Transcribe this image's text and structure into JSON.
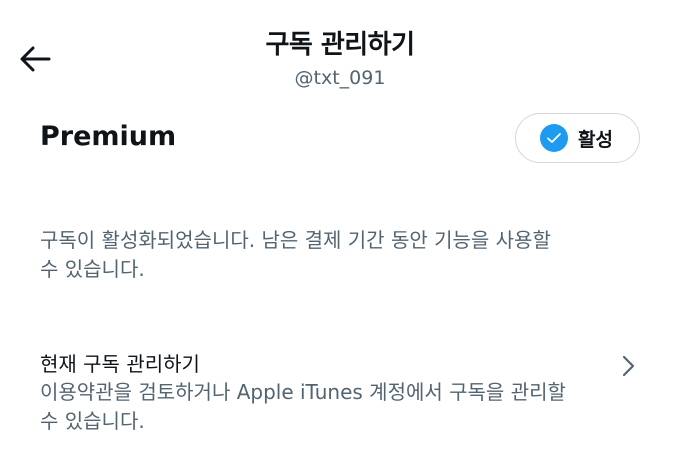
{
  "header": {
    "back_icon": "arrow-left-icon",
    "title": "구독 관리하기",
    "handle": "@txt_091"
  },
  "plan": {
    "name": "Premium",
    "status_icon": "check-circle-icon",
    "status_label": "활성",
    "accent_color": "#1d9bf0"
  },
  "description": {
    "line1": "구독이 활성화되었습니다. 남은 결제 기간 동안 기능을 사용할",
    "line2": "수 있습니다."
  },
  "manage": {
    "title": "현재 구독 관리하기",
    "desc_line1": "이용약관을 검토하거나 Apple iTunes 계정에서 구독을 관리할",
    "desc_line2": "수 있습니다.",
    "chevron_icon": "chevron-right-icon"
  }
}
